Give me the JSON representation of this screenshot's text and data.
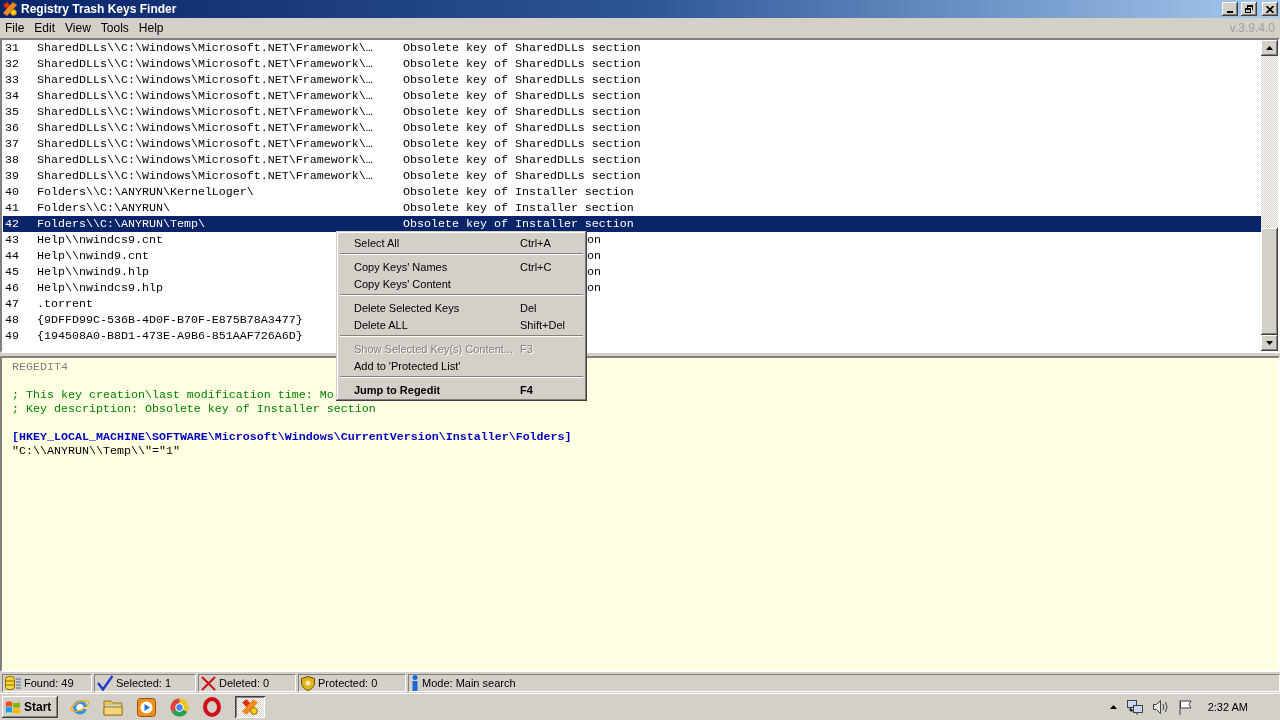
{
  "window": {
    "title": "Registry Trash Keys Finder"
  },
  "menu_bar": {
    "items": [
      "File",
      "Edit",
      "View",
      "Tools",
      "Help"
    ],
    "version": "v.3.9.4.0"
  },
  "results_list": {
    "rows": [
      {
        "number": "31",
        "key": "SharedDLLs\\\\C:\\Windows\\Microsoft.NET\\Framework\\…",
        "description": "Obsolete key of SharedDLLs section",
        "kind": "full",
        "selected": false
      },
      {
        "number": "32",
        "key": "SharedDLLs\\\\C:\\Windows\\Microsoft.NET\\Framework\\…",
        "description": "Obsolete key of SharedDLLs section",
        "kind": "full",
        "selected": false
      },
      {
        "number": "33",
        "key": "SharedDLLs\\\\C:\\Windows\\Microsoft.NET\\Framework\\…",
        "description": "Obsolete key of SharedDLLs section",
        "kind": "full",
        "selected": false
      },
      {
        "number": "34",
        "key": "SharedDLLs\\\\C:\\Windows\\Microsoft.NET\\Framework\\…",
        "description": "Obsolete key of SharedDLLs section",
        "kind": "full",
        "selected": false
      },
      {
        "number": "35",
        "key": "SharedDLLs\\\\C:\\Windows\\Microsoft.NET\\Framework\\…",
        "description": "Obsolete key of SharedDLLs section",
        "kind": "full",
        "selected": false
      },
      {
        "number": "36",
        "key": "SharedDLLs\\\\C:\\Windows\\Microsoft.NET\\Framework\\…",
        "description": "Obsolete key of SharedDLLs section",
        "kind": "full",
        "selected": false
      },
      {
        "number": "37",
        "key": "SharedDLLs\\\\C:\\Windows\\Microsoft.NET\\Framework\\…",
        "description": "Obsolete key of SharedDLLs section",
        "kind": "full",
        "selected": false
      },
      {
        "number": "38",
        "key": "SharedDLLs\\\\C:\\Windows\\Microsoft.NET\\Framework\\…",
        "description": "Obsolete key of SharedDLLs section",
        "kind": "full",
        "selected": false
      },
      {
        "number": "39",
        "key": "SharedDLLs\\\\C:\\Windows\\Microsoft.NET\\Framework\\…",
        "description": "Obsolete key of SharedDLLs section",
        "kind": "full",
        "selected": false
      },
      {
        "number": "40",
        "key": "Folders\\\\C:\\ANYRUN\\KernelLoger\\",
        "description": "Obsolete key of Installer section",
        "kind": "full",
        "selected": false
      },
      {
        "number": "41",
        "key": "Folders\\\\C:\\ANYRUN\\",
        "description": "Obsolete key of Installer section",
        "kind": "full",
        "selected": false
      },
      {
        "number": "42",
        "key": "Folders\\\\C:\\ANYRUN\\Temp\\",
        "description": "Obsolete key of Installer section",
        "kind": "full",
        "selected": true
      },
      {
        "number": "43",
        "key": "Help\\\\nwindcs9.cnt",
        "description": "on",
        "kind": "covered",
        "selected": false
      },
      {
        "number": "44",
        "key": "Help\\\\nwind9.cnt",
        "description": "on",
        "kind": "covered",
        "selected": false
      },
      {
        "number": "45",
        "key": "Help\\\\nwind9.hlp",
        "description": "on",
        "kind": "covered",
        "selected": false
      },
      {
        "number": "46",
        "key": "Help\\\\nwindcs9.hlp",
        "description": "on",
        "kind": "covered",
        "selected": false
      },
      {
        "number": "47",
        "key": ".torrent",
        "selected": false
      },
      {
        "number": "48",
        "key": "{9DFFD99C-536B-4D0F-B70F-E875B78A3477}",
        "selected": false
      },
      {
        "number": "49",
        "key": "{194508A0-B8D1-473E-A9B6-851AAF726A6D}",
        "selected": false
      }
    ]
  },
  "context_menu": {
    "groups": [
      [
        {
          "label": "Select All",
          "shortcut": "Ctrl+A",
          "disabled": false,
          "default": false
        }
      ],
      [
        {
          "label": "Copy Keys' Names",
          "shortcut": "Ctrl+C",
          "disabled": false,
          "default": false
        },
        {
          "label": "Copy Keys' Content",
          "disabled": false,
          "default": false
        }
      ],
      [
        {
          "label": "Delete Selected Keys",
          "shortcut": "Del",
          "disabled": false,
          "default": false
        },
        {
          "label": "Delete ALL",
          "shortcut": "Shift+Del",
          "disabled": false,
          "default": false
        }
      ],
      [
        {
          "label": "Show Selected Key(s) Content...",
          "shortcut": "F3",
          "disabled": true,
          "default": false
        },
        {
          "label": "Add to 'Protected List'",
          "disabled": false,
          "default": false
        }
      ],
      [
        {
          "label": "Jump to Regedit",
          "shortcut": "F4",
          "disabled": false,
          "default": true
        }
      ]
    ]
  },
  "details_pane": {
    "blocks": [
      [
        {
          "kind": "header",
          "text": "REGEDIT4"
        }
      ],
      [
        {
          "kind": "comment",
          "text": "; This key creation\\last modification time: Mo"
        },
        {
          "kind": "comment",
          "text": "; Key description: Obsolete key of Installer section"
        }
      ],
      [
        {
          "kind": "key",
          "text": "[HKEY_LOCAL_MACHINE\\SOFTWARE\\Microsoft\\Windows\\CurrentVersion\\Installer\\Folders]"
        },
        {
          "kind": "value",
          "text": "\"C:\\\\ANYRUN\\\\Temp\\\\\"=\"1\""
        }
      ]
    ]
  },
  "status_bar": [
    {
      "kind": "found",
      "text": "Found: 49"
    },
    {
      "kind": "selected",
      "text": "Selected: 1"
    },
    {
      "kind": "deleted",
      "text": "Deleted: 0"
    },
    {
      "kind": "protected",
      "text": "Protected: 0"
    },
    {
      "kind": "mode",
      "text": "Mode: Main search"
    }
  ],
  "taskbar": {
    "start_label": "Start",
    "buttons": [
      {
        "kind": "web",
        "selected": false
      },
      {
        "kind": "folder",
        "selected": false
      },
      {
        "kind": "player",
        "selected": false
      },
      {
        "kind": "wheel",
        "selected": false
      },
      {
        "kind": "ring",
        "selected": false
      },
      {
        "kind": "app",
        "selected": true
      }
    ],
    "clock": "2:32 AM"
  }
}
